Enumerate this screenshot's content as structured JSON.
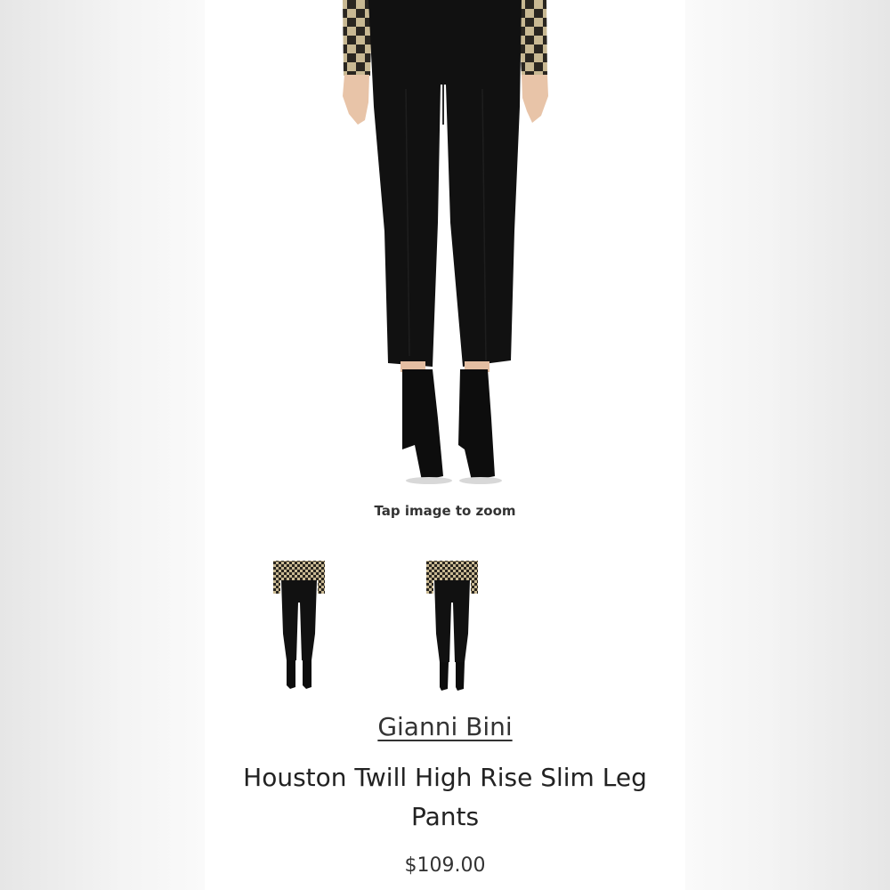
{
  "product": {
    "zoom_hint": "Tap image to zoom",
    "brand": "Gianni Bini",
    "title": "Houston Twill High Rise Slim Leg Pants",
    "price": "$109.00",
    "main_image": "product-photo-black-slim-pants",
    "thumbnails": [
      "thumbnail-front-view",
      "thumbnail-alt-view"
    ]
  },
  "colors": {
    "page_background": "#ffffff",
    "side_background": "#efefef",
    "pants": "#111111",
    "text": "#222222"
  }
}
